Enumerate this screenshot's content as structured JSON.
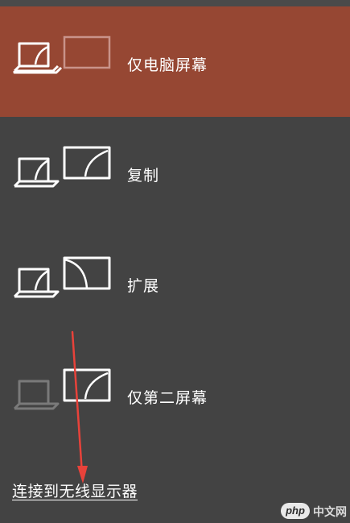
{
  "options": [
    {
      "label": "仅电脑屏幕",
      "selected": true
    },
    {
      "label": "复制",
      "selected": false
    },
    {
      "label": "扩展",
      "selected": false
    },
    {
      "label": "仅第二屏幕",
      "selected": false
    }
  ],
  "connect_link": "连接到无线显示器",
  "watermark": {
    "logo": "php",
    "text": "中文网"
  },
  "colors": {
    "panel_bg": "#434343",
    "selected_bg": "#964733",
    "icon_stroke": "#ffffff",
    "icon_dim": "#7a7a7a",
    "arrow": "#e8423a"
  },
  "icons": [
    "laptop-icon",
    "monitor-icon"
  ]
}
